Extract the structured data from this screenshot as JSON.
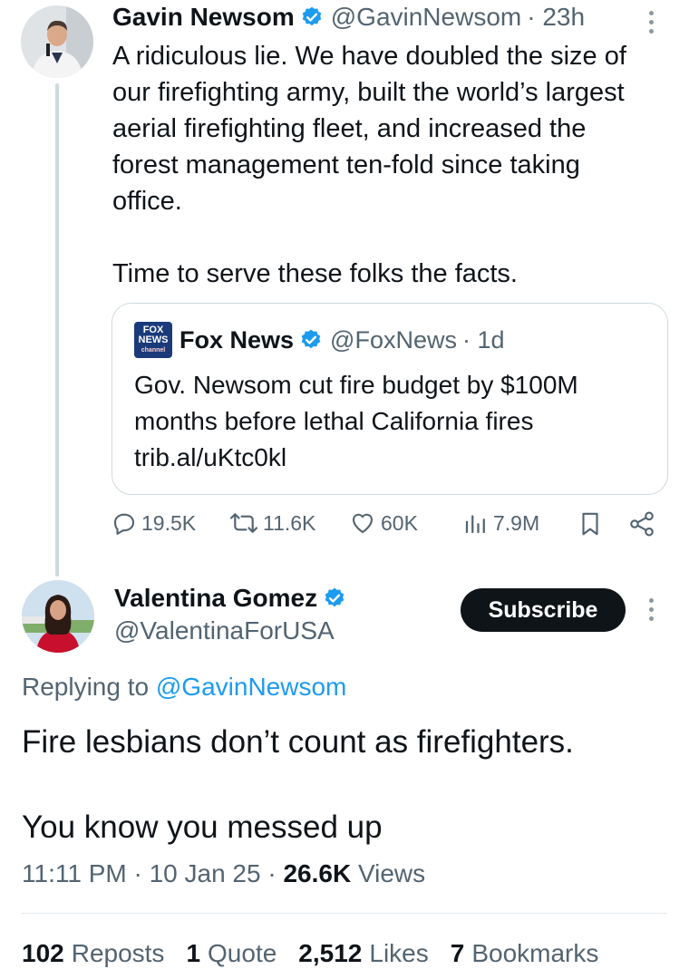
{
  "tweet": {
    "author_name": "Gavin Newsom",
    "handle": "@GavinNewsom",
    "time": "· 23h",
    "text": "A ridiculous lie. We have doubled the size of\nour firefighting army, built the world’s largest\naerial firefighting fleet, and increased the\nforest management ten-fold since taking\noffice.\n\nTime to serve these folks the facts.",
    "quote": {
      "logo_text": "FOX",
      "logo_text2": "NEWS",
      "logo_sub": "channel",
      "author_name": "Fox News",
      "handle": "@FoxNews",
      "time": "· 1d",
      "text": "Gov. Newsom cut fire budget by $100M\nmonths before lethal California fires\ntrib.al/uKtc0kl"
    },
    "actions": {
      "replies": "19.5K",
      "reposts": "11.6K",
      "likes": "60K",
      "views": "7.9M"
    }
  },
  "reply": {
    "author_name": "Valentina Gomez",
    "handle": "@ValentinaForUSA",
    "subscribe_label": "Subscribe",
    "replying_prefix": "Replying to",
    "replying_handle": "@GavinNewsom",
    "text": "Fire lesbians don’t count as firefighters.\n\nYou know you messed up",
    "time": "11:11 PM · 10 Jan 25 ·",
    "views_count": "26.6K",
    "views_label": "Views",
    "stats": [
      {
        "count": "102",
        "label": "Reposts"
      },
      {
        "count": "1",
        "label": "Quote"
      },
      {
        "count": "2,512",
        "label": "Likes"
      },
      {
        "count": "7",
        "label": "Bookmarks"
      }
    ]
  },
  "colors": {
    "verified": "#1d9bf0",
    "text": "#0f1419",
    "secondary": "#536471",
    "link": "#1d9bf0"
  }
}
